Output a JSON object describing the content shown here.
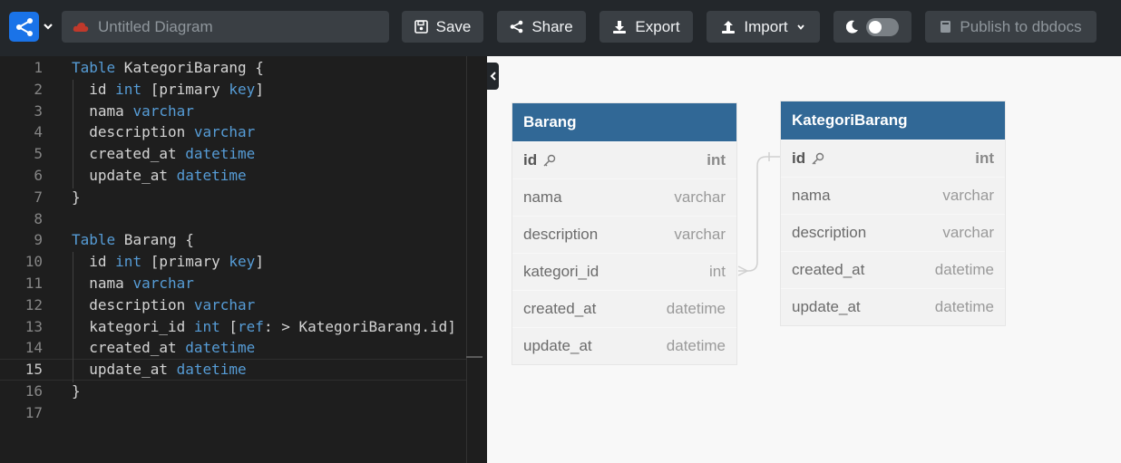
{
  "header": {
    "diagram_title_placeholder": "Untitled Diagram",
    "diagram_title_value": "",
    "save_label": "Save",
    "share_label": "Share",
    "export_label": "Export",
    "import_label": "Import",
    "publish_label": "Publish to dbdocs"
  },
  "editor": {
    "lines": [
      {
        "n": "1",
        "tokens": [
          {
            "t": "Table",
            "c": "kw"
          },
          {
            "t": " KategoriBarang {",
            "c": ""
          }
        ]
      },
      {
        "n": "2",
        "tokens": [
          {
            "t": "  id ",
            "c": ""
          },
          {
            "t": "int",
            "c": "ty"
          },
          {
            "t": " [primary ",
            "c": ""
          },
          {
            "t": "key",
            "c": "kw"
          },
          {
            "t": "]",
            "c": ""
          }
        ]
      },
      {
        "n": "3",
        "tokens": [
          {
            "t": "  nama ",
            "c": ""
          },
          {
            "t": "varchar",
            "c": "ty"
          }
        ]
      },
      {
        "n": "4",
        "tokens": [
          {
            "t": "  description ",
            "c": ""
          },
          {
            "t": "varchar",
            "c": "ty"
          }
        ]
      },
      {
        "n": "5",
        "tokens": [
          {
            "t": "  created_at ",
            "c": ""
          },
          {
            "t": "datetime",
            "c": "ty"
          }
        ]
      },
      {
        "n": "6",
        "tokens": [
          {
            "t": "  update_at ",
            "c": ""
          },
          {
            "t": "datetime",
            "c": "ty"
          }
        ]
      },
      {
        "n": "7",
        "tokens": [
          {
            "t": "}",
            "c": ""
          }
        ]
      },
      {
        "n": "8",
        "tokens": []
      },
      {
        "n": "9",
        "tokens": [
          {
            "t": "Table",
            "c": "kw"
          },
          {
            "t": " Barang {",
            "c": ""
          }
        ]
      },
      {
        "n": "10",
        "tokens": [
          {
            "t": "  id ",
            "c": ""
          },
          {
            "t": "int",
            "c": "ty"
          },
          {
            "t": " [primary ",
            "c": ""
          },
          {
            "t": "key",
            "c": "kw"
          },
          {
            "t": "]",
            "c": ""
          }
        ]
      },
      {
        "n": "11",
        "tokens": [
          {
            "t": "  nama ",
            "c": ""
          },
          {
            "t": "varchar",
            "c": "ty"
          }
        ]
      },
      {
        "n": "12",
        "tokens": [
          {
            "t": "  description ",
            "c": ""
          },
          {
            "t": "varchar",
            "c": "ty"
          }
        ]
      },
      {
        "n": "13",
        "tokens": [
          {
            "t": "  kategori_id ",
            "c": ""
          },
          {
            "t": "int",
            "c": "ty"
          },
          {
            "t": " [",
            "c": ""
          },
          {
            "t": "ref",
            "c": "kw"
          },
          {
            "t": ": > KategoriBarang.id]",
            "c": ""
          }
        ]
      },
      {
        "n": "14",
        "tokens": [
          {
            "t": "  created_at ",
            "c": ""
          },
          {
            "t": "datetime",
            "c": "ty"
          }
        ]
      },
      {
        "n": "15",
        "tokens": [
          {
            "t": "  update_at ",
            "c": ""
          },
          {
            "t": "datetime",
            "c": "ty"
          }
        ]
      },
      {
        "n": "16",
        "tokens": [
          {
            "t": "}",
            "c": ""
          }
        ]
      },
      {
        "n": "17",
        "tokens": []
      }
    ],
    "active_line": "15"
  },
  "diagram": {
    "tables": [
      {
        "name": "Barang",
        "fields": [
          {
            "name": "id",
            "type": "int",
            "pk": true
          },
          {
            "name": "nama",
            "type": "varchar"
          },
          {
            "name": "description",
            "type": "varchar"
          },
          {
            "name": "kategori_id",
            "type": "int"
          },
          {
            "name": "created_at",
            "type": "datetime"
          },
          {
            "name": "update_at",
            "type": "datetime"
          }
        ]
      },
      {
        "name": "KategoriBarang",
        "fields": [
          {
            "name": "id",
            "type": "int",
            "pk": true
          },
          {
            "name": "nama",
            "type": "varchar"
          },
          {
            "name": "description",
            "type": "varchar"
          },
          {
            "name": "created_at",
            "type": "datetime"
          },
          {
            "name": "update_at",
            "type": "datetime"
          }
        ]
      }
    ]
  },
  "colors": {
    "brand": "#1a73e8",
    "table_header": "#316896",
    "keyword": "#569cd6",
    "cloud_icon": "#c0392b"
  },
  "icons": {
    "logo": "share-nodes-icon",
    "title_status": "cloud-icon",
    "save": "floppy-disk-icon",
    "share": "share-icon",
    "export": "download-icon",
    "import": "upload-icon",
    "theme": "moon-icon",
    "publish": "book-icon",
    "primary_key": "key-icon",
    "collapse": "chevron-left-icon"
  }
}
